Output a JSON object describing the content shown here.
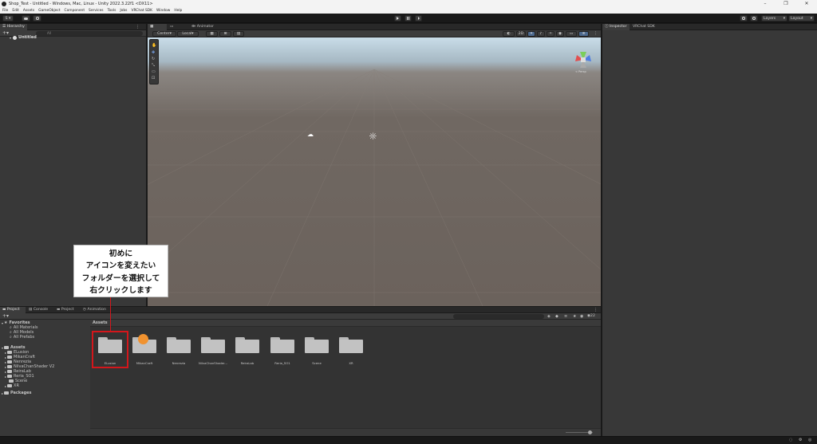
{
  "titlebar": {
    "title": "Shop_Test - Untitled - Windows, Mac, Linux - Unity 2022.3.22f1 <DX11>",
    "min": "–",
    "max": "❐",
    "close": "✕"
  },
  "menu": [
    "File",
    "Edit",
    "Assets",
    "GameObject",
    "Component",
    "Services",
    "Tools",
    "Jobs",
    "VRChat SDK",
    "Window",
    "Help"
  ],
  "toolbar": {
    "account": "S ▾",
    "layers": "Layers",
    "layout": "Layout"
  },
  "hierarchy": {
    "tab": "Hierarchy",
    "search_placeholder": "All",
    "scene": "Untitled"
  },
  "scene_tabs": [
    "Scene",
    "Game",
    "Animator"
  ],
  "scene_toolbar": {
    "pivot": "Center",
    "space": "Local",
    "mode2d": "2D",
    "persp": "< Persp"
  },
  "inspector_tabs": [
    "Inspector",
    "VRChat SDK"
  ],
  "project_tabs": [
    "Project",
    "Console",
    "Project",
    "Animation"
  ],
  "project": {
    "favorites": {
      "label": "Favorites",
      "items": [
        "All Materials",
        "All Models",
        "All Prefabs"
      ]
    },
    "assets": {
      "label": "Assets",
      "items": [
        "ELusion",
        "MikanCraft",
        "Nenrezia",
        "NilvaChanShader V2",
        "ReiraLab",
        "Reria_SO1",
        "Scene",
        "XR"
      ]
    },
    "packages": "Packages",
    "breadcrumb": "Assets",
    "count": "22",
    "folders": [
      "ELusion",
      "MikanCraft",
      "Nenrezia",
      "NilvaChanShader...",
      "ReiraLab",
      "Reria_SO1",
      "Scene",
      "XR"
    ]
  },
  "callout": {
    "lines": [
      "初めに",
      "アイコンを変えたい",
      "フォルダーを選択して",
      "右クリックします"
    ]
  },
  "colors": {
    "highlight": "#d4161b",
    "sky": "#c9dde9",
    "ground": "#6b625c"
  }
}
